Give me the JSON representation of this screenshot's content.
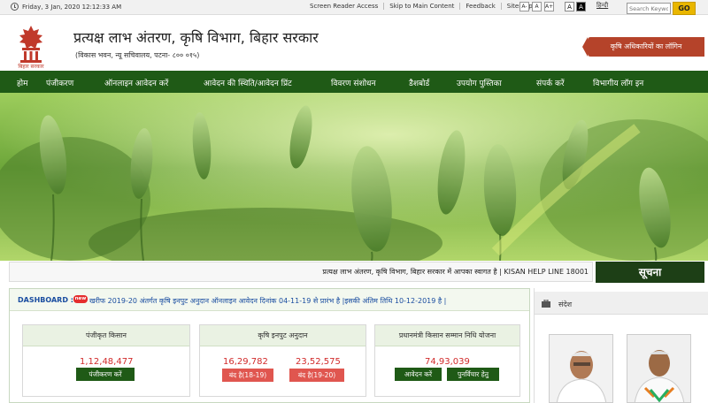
{
  "topbar": {
    "date": "Friday, 3 Jan, 2020 12:12:33 AM",
    "links": [
      "Screen Reader Access",
      "Skip to Main Content",
      "Feedback",
      "Sitemap"
    ],
    "font_buttons": [
      "A-",
      "A",
      "A+"
    ],
    "contrast_buttons": [
      "A",
      "A"
    ],
    "language": "हिन्दी",
    "search_placeholder": "Search Keywor",
    "go_label": "GO"
  },
  "header": {
    "emblem_caption": "बिहार सरकार",
    "title": "प्रत्यक्ष लाभ अंतरण, कृषि विभाग, बिहार सरकार",
    "subtitle": "(विकास भवन, न्यू सचिवालय, पटना- ८०० ०१५)",
    "ribbon": "कृषि अधिकारियों का लॉगिन"
  },
  "nav": {
    "items": [
      "होम",
      "पंजीकरण",
      "ऑनलाइन आवेदन करें",
      "आवेदन की स्थिति/आवेदन प्रिंट",
      "विवरण संशोधन",
      "डैशबोर्ड",
      "उपयोग पुस्तिका",
      "संपर्क करें",
      "विभागीय लॉग इन"
    ]
  },
  "ticker": {
    "text": "प्रत्यक्ष लाभ अंतरण, कृषि विभाग, बिहार सरकार में आपका स्वागत है | KISAN HELP LINE 18001",
    "suchna_label": "सूचना"
  },
  "dashboard": {
    "label": "DASHBOARD ::",
    "new_badge": "new",
    "message": "खरीफ 2019-20 अंतर्गत कृषि इनपुट अनुदान ऑनलाइन आवेदन दिनांक 04-11-19 से प्रारंभ है |इसकी अंतिम तिथि 10-12-2019 है |",
    "cards": [
      {
        "title": "पंजीकृत किसान",
        "value": "1,12,48,477",
        "button": "पंजीकरण करें"
      },
      {
        "title": "कृषि इनपुट अनुदान",
        "value1": "16,29,782",
        "value2": "23,52,575",
        "button1": "बंद है(18-19)",
        "button2": "बंद है(19-20)"
      },
      {
        "title": "प्रधानमंत्री किसान सम्मान निधि योजना",
        "value": "74,93,039",
        "button1": "आवेदन करें",
        "button2": "पुनर्विचार हेतु"
      }
    ]
  },
  "sandesh": {
    "title": "संदेश"
  },
  "colors": {
    "nav_green": "#1f5a16",
    "ribbon": "#b5432a",
    "go_button": "#e9b600",
    "number_red": "#d12b2b",
    "closed_button": "#e0564f"
  }
}
